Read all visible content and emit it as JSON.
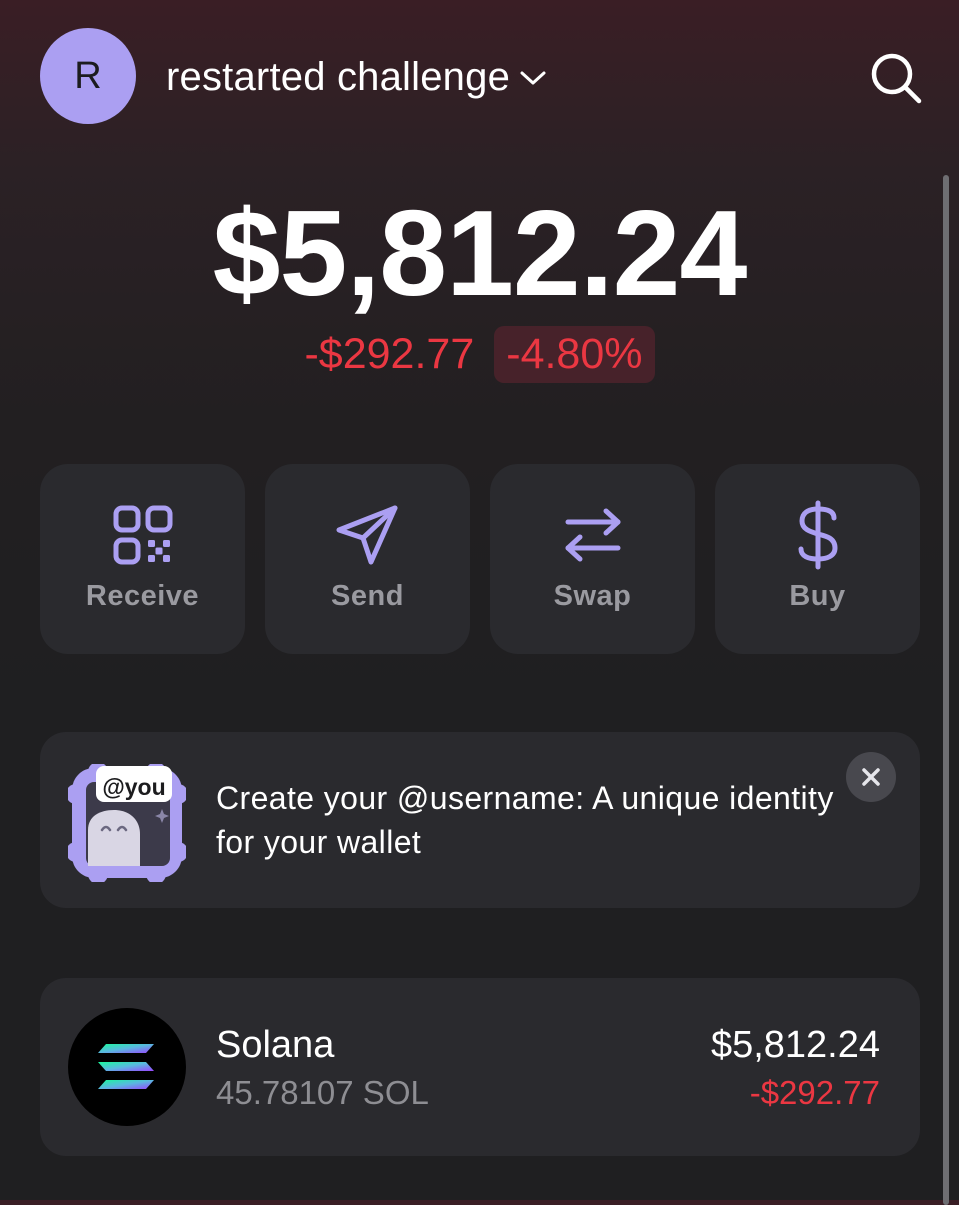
{
  "header": {
    "avatar_initial": "R",
    "account_name": "restarted challenge",
    "icons": [
      "chevron-down-icon",
      "search-icon"
    ]
  },
  "portfolio": {
    "balance": "$5,812.24",
    "change_amount": "-$292.77",
    "change_percent": "-4.80%"
  },
  "actions": [
    {
      "label": "Receive",
      "icon": "qr-code-icon"
    },
    {
      "label": "Send",
      "icon": "paper-plane-icon"
    },
    {
      "label": "Swap",
      "icon": "swap-arrows-icon"
    },
    {
      "label": "Buy",
      "icon": "dollar-icon"
    }
  ],
  "banner": {
    "badge": "@you",
    "text": "Create your @username: A unique identity for your wallet"
  },
  "tokens": [
    {
      "name": "Solana",
      "amount": "45.78107 SOL",
      "value": "$5,812.24",
      "change": "-$292.77"
    }
  ],
  "colors": {
    "accent": "#ab9ff2",
    "negative": "#eb3742",
    "card": "#2a2a2e",
    "text_secondary": "#9a9aa0"
  }
}
